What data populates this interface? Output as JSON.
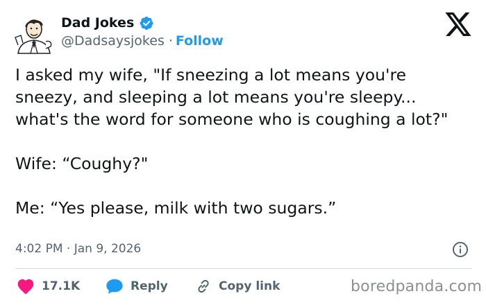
{
  "author": {
    "name": "Dad Jokes",
    "handle": "@Dadsaysjokes",
    "separator": "·",
    "follow_label": "Follow",
    "verified": true
  },
  "tweet": {
    "paragraphs": [
      "I asked my wife, \"If sneezing a lot means you're sneezy, and sleeping a lot means you're sleepy... what's the word for someone who is coughing a lot?\"",
      "Wife: “Coughy?\"",
      "Me: “Yes please, milk with two sugars.”"
    ],
    "timestamp": "4:02 PM · Jan 9, 2026"
  },
  "actions": {
    "like_count": "17.1K",
    "reply_label": "Reply",
    "copy_label": "Copy link"
  },
  "watermark": "boredpanda.com",
  "colors": {
    "accent": "#1d9bf0",
    "like": "#f91880",
    "text": "#0f1419",
    "muted": "#536471"
  },
  "icons": [
    "avatar-illustration",
    "verified-badge-icon",
    "x-logo-icon",
    "info-icon",
    "heart-icon",
    "reply-bubble-icon",
    "link-icon"
  ]
}
